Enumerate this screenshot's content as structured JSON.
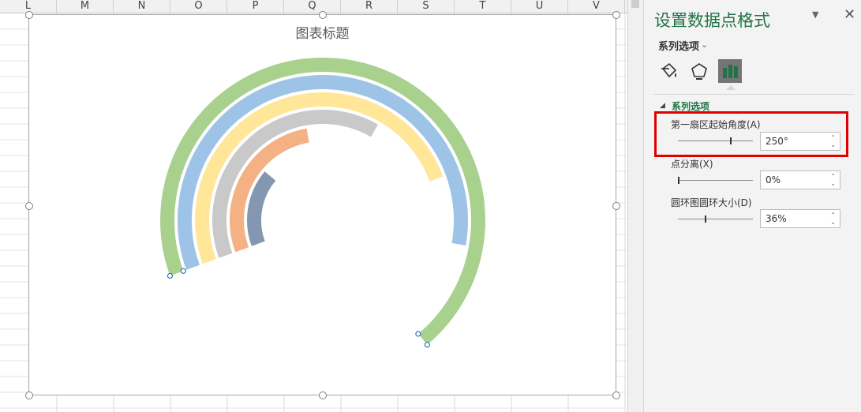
{
  "spreadsheet": {
    "columns": [
      "L",
      "M",
      "N",
      "O",
      "P",
      "Q",
      "R",
      "S",
      "T",
      "U",
      "V"
    ]
  },
  "chart": {
    "title": "图表标题"
  },
  "chart_data": {
    "type": "doughnut",
    "first_slice_angle": 250,
    "hole_size_percent": 36,
    "rings": [
      {
        "color": "#A9D18E",
        "sweep_degrees": 250
      },
      {
        "color": "#9DC3E6",
        "sweep_degrees": 210
      },
      {
        "color": "#FFE699",
        "sweep_degrees": 180
      },
      {
        "color": "#C9C9C9",
        "sweep_degrees": 140
      },
      {
        "color": "#F4B183",
        "sweep_degrees": 100
      },
      {
        "color": "#8497B0",
        "sweep_degrees": 60
      }
    ]
  },
  "pane": {
    "title": "设置数据点格式",
    "series_dropdown": "系列选项",
    "tabs": [
      "fill-line-icon",
      "effects-icon",
      "series-options-icon"
    ],
    "section_title": "系列选项",
    "fields": [
      {
        "label": "第一扇区起始角度(A)",
        "value": "250°",
        "slider_fraction": 0.69
      },
      {
        "label": "点分离(X)",
        "value": "0%",
        "slider_fraction": 0.0
      },
      {
        "label": "圆环图圆环大小(D)",
        "value": "36%",
        "slider_fraction": 0.36
      }
    ]
  },
  "colors": {
    "accent": "#217346",
    "highlight": "#E00000"
  }
}
